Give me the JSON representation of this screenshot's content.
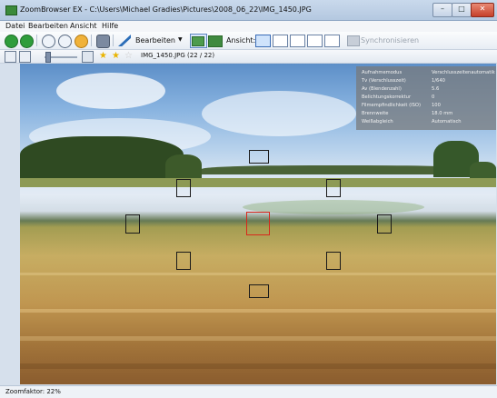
{
  "window": {
    "title": "ZoomBrowser EX - C:\\Users\\Michael Gradies\\Pictures\\2008_06_22\\IMG_1450.JPG",
    "controls": {
      "minimize": "–",
      "maximize": "□",
      "close": "✕"
    }
  },
  "menu": [
    "Datei",
    "Bearbeiten",
    "Ansicht",
    "Hilfe"
  ],
  "toolbar": {
    "edit_label": "Bearbeiten",
    "view_label": "Ansicht:",
    "sync_label": "Synchronisieren"
  },
  "toolbar2": {
    "filename": "IMG_1450.JPG (22 / 22)",
    "rating": {
      "value": 2,
      "max": 3
    }
  },
  "info": [
    {
      "key": "Aufnahmemodus",
      "value": "Verschlusszeitenautomatik"
    },
    {
      "key": "Tv (Verschlusszeit)",
      "value": "1/640"
    },
    {
      "key": "Av (Blendenzahl)",
      "value": "5.6"
    },
    {
      "key": "Belichtungskorrektur",
      "value": "0"
    },
    {
      "key": "Filmempfindlichkeit (ISO)",
      "value": "100"
    },
    {
      "key": "Brennweite",
      "value": "18.0 mm"
    },
    {
      "key": "Weißabgleich",
      "value": "Automatisch"
    }
  ],
  "status": {
    "zoom": "Zoomfaktor: 22%"
  },
  "colors": {
    "af_active": "#d8281c",
    "af_inactive": "#1a1a1a",
    "star": "#e9b400"
  }
}
